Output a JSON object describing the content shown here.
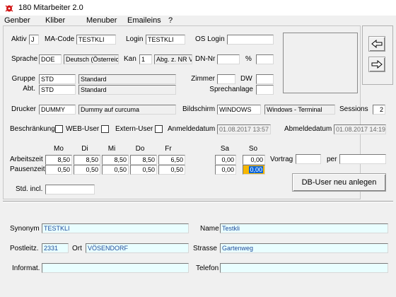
{
  "window": {
    "title": "180 Mitarbeiter 2.0"
  },
  "menu": {
    "items": [
      "Genber",
      "Kliber",
      "Menuber",
      "Emaileins",
      "?"
    ]
  },
  "general": {
    "aktiv_label": "Aktiv",
    "aktiv_value": "J",
    "macode_label": "MA-Code",
    "macode_value": "TESTKLI",
    "login_label": "Login",
    "login_value": "TESTKLI",
    "oslogin_label": "OS Login",
    "oslogin_value": "",
    "sprache_label": "Sprache",
    "sprache_code": "DOE",
    "sprache_text": "Deutsch (Österreic",
    "kan_label": "Kan",
    "kan_value": "1",
    "kan_text": "Abg. z. NR V",
    "dnnr_label": "DN-Nr",
    "dnnr_value": "",
    "percent_label": "%",
    "percent_value": "",
    "gruppe_label": "Gruppe",
    "gruppe_code": "STD",
    "gruppe_text": "Standard",
    "abt_label": "Abt.",
    "abt_code": "STD",
    "abt_text": "Standard",
    "zimmer_label": "Zimmer",
    "zimmer_value": "",
    "dw_label": "DW",
    "dw_value": "",
    "sprechanlage_label": "Sprechanlage",
    "sprechanlage_value": "",
    "drucker_label": "Drucker",
    "drucker_code": "DUMMY",
    "drucker_text": "Dummy auf curcuma",
    "bildschirm_label": "Bildschirm",
    "bildschirm_code": "WINDOWS",
    "bildschirm_text": "Windows - Terminal",
    "sessions_label": "Sessions",
    "sessions_value": "2",
    "beschraenkung_label": "Beschränkung",
    "webuser_label": "WEB-User",
    "externuser_label": "Extern-User",
    "anmelde_label": "Anmeldedatum",
    "anmelde_value": "01.08.2017 13:57",
    "abmelde_label": "Abmeldedatum",
    "abmelde_value": "01.08.2017 14:19"
  },
  "schedule": {
    "arbeitszeit_label": "Arbeitszeit",
    "pausenzeit_label": "Pausenzeit",
    "days": [
      "Mo",
      "Di",
      "Mi",
      "Do",
      "Fr",
      "Sa",
      "So"
    ],
    "arbeitszeit": [
      "8,50",
      "8,50",
      "8,50",
      "8,50",
      "6,50",
      "0,00",
      "0,00"
    ],
    "pausenzeit": [
      "0,50",
      "0,50",
      "0,50",
      "0,50",
      "0,50",
      "0,00",
      "0,00"
    ],
    "vortrag_label": "Vortrag",
    "vortrag_value": "",
    "per_label": "per",
    "per_value": "",
    "stdincl_label": "Std. incl.",
    "stdincl_value": ""
  },
  "actions": {
    "db_user_button": "DB-User neu anlegen"
  },
  "contact": {
    "synonym_label": "Synonym",
    "synonym_value": "TESTKLI",
    "name_label": "Name",
    "name_value": "Testkli",
    "postleitz_label": "Postleitz.",
    "postleitz_value": "2331",
    "ort_label": "Ort",
    "ort_value": "VÖSENDORF",
    "strasse_label": "Strasse",
    "strasse_value": "Gartenweg",
    "informat_label": "Informat.",
    "informat_value": "",
    "telefon_label": "Telefon",
    "telefon_value": ""
  },
  "icons": {
    "app": "app-bug-icon",
    "nav_prev": "arrow-left-icon",
    "nav_next": "arrow-right-icon"
  },
  "colors": {
    "highlight": "#f7b700",
    "contact_field_bg": "#e9feff",
    "contact_text": "#1e4c9c",
    "selection": "#0a64d8"
  }
}
